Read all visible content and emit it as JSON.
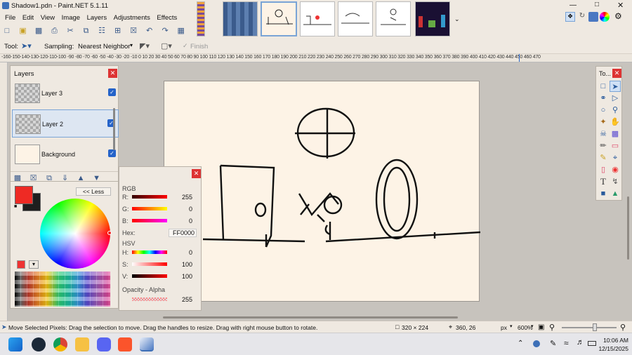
{
  "window": {
    "title": "Shadow1.pdn - Paint.NET 5.1.11"
  },
  "menu": [
    "File",
    "Edit",
    "View",
    "Image",
    "Layers",
    "Adjustments",
    "Effects"
  ],
  "toolbar2": {
    "tool_label": "Tool:",
    "sampling_label": "Sampling:",
    "sampling_value": "Nearest Neighbor",
    "finish_label": "Finish"
  },
  "ruler": {
    "top_ticks": "-160-150-140-130-120-110-100 -90 -80 -70 -60 -50 -40 -30 -20 -10  0  10  20  30  40  50  60  70  80  90 100 110 120 130 140 150 160 170 180 190 200 210 220 230 240 250 260 270 280 290 300 310 320 330 340 350 360 370 380 390 400 410 420 430 440 450 460 470"
  },
  "layers_panel": {
    "title": "Layers",
    "layers": [
      {
        "name": "Layer 3",
        "visible": true
      },
      {
        "name": "Layer 2",
        "visible": true,
        "selected": true
      },
      {
        "name": "Background",
        "visible": true
      }
    ]
  },
  "colors_panel": {
    "less_label": "<< Less",
    "rgb_label": "RGB",
    "r_label": "R:",
    "r_value": "255",
    "g_label": "G:",
    "g_value": "0",
    "b_label": "B:",
    "b_value": "0",
    "hex_label": "Hex:",
    "hex_value": "FF0000",
    "hsv_label": "HSV",
    "h_label": "H:",
    "h_value": "0",
    "s_label": "S:",
    "s_value": "100",
    "v_label": "V:",
    "v_value": "100",
    "opacity_label": "Opacity - Alpha",
    "opacity_value": "255",
    "primary_color": "#ee2a24",
    "secondary_color": "#1e1e1e"
  },
  "tools_panel": {
    "title": "To..."
  },
  "statusbar": {
    "hint": "Move Selected Pixels: Drag the selection to move. Drag the handles to resize. Drag with right mouse button to rotate.",
    "selection_size": "320 × 224",
    "cursor_pos": "360, 26",
    "units": "px",
    "zoom": "600%"
  },
  "taskbar": {
    "time": "10:06 AM",
    "date": "12/15/2025"
  },
  "colors": {
    "accent": "#2563c9",
    "close": "#d33333",
    "canvas": "#fdf3e6"
  }
}
